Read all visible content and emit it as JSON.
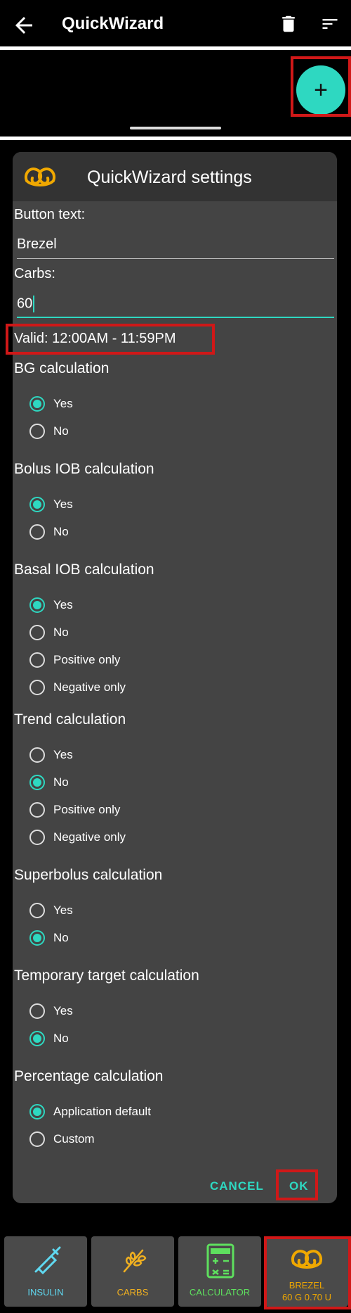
{
  "topbar": {
    "title": "QuickWizard"
  },
  "fab": {
    "label": "+"
  },
  "dialog": {
    "title": "QuickWizard settings",
    "button_text_label": "Button text:",
    "button_text_value": "Brezel",
    "carbs_label": "Carbs:",
    "carbs_value": "60",
    "valid": "Valid:  12:00AM  -  11:59PM",
    "sections": [
      {
        "title": "BG calculation",
        "options": [
          "Yes",
          "No"
        ],
        "selected": "Yes"
      },
      {
        "title": "Bolus IOB calculation",
        "options": [
          "Yes",
          "No"
        ],
        "selected": "Yes"
      },
      {
        "title": "Basal IOB calculation",
        "options": [
          "Yes",
          "No",
          "Positive only",
          "Negative only"
        ],
        "selected": "Yes"
      },
      {
        "title": "Trend calculation",
        "options": [
          "Yes",
          "No",
          "Positive only",
          "Negative only"
        ],
        "selected": "No"
      },
      {
        "title": "Superbolus calculation",
        "options": [
          "Yes",
          "No"
        ],
        "selected": "No"
      },
      {
        "title": "Temporary target calculation",
        "options": [
          "Yes",
          "No"
        ],
        "selected": "No"
      },
      {
        "title": "Percentage calculation",
        "options": [
          "Application default",
          "Custom"
        ],
        "selected": "Application default"
      }
    ],
    "cancel_label": "CANCEL",
    "ok_label": "OK"
  },
  "bottom_bar": {
    "insulin": {
      "label": "INSULIN",
      "color": "#5fd8f0"
    },
    "carbs": {
      "label": "CARBS",
      "color": "#f0b020"
    },
    "calculator": {
      "label": "CALCULATOR",
      "color": "#5ee05e"
    },
    "quick": {
      "label_line1": "BREZEL",
      "label_line2": "60 G 0.70 U",
      "color": "#f0a800"
    }
  },
  "colors": {
    "accent": "#2ed8c1",
    "highlight": "#d01818",
    "surface": "#444444"
  }
}
